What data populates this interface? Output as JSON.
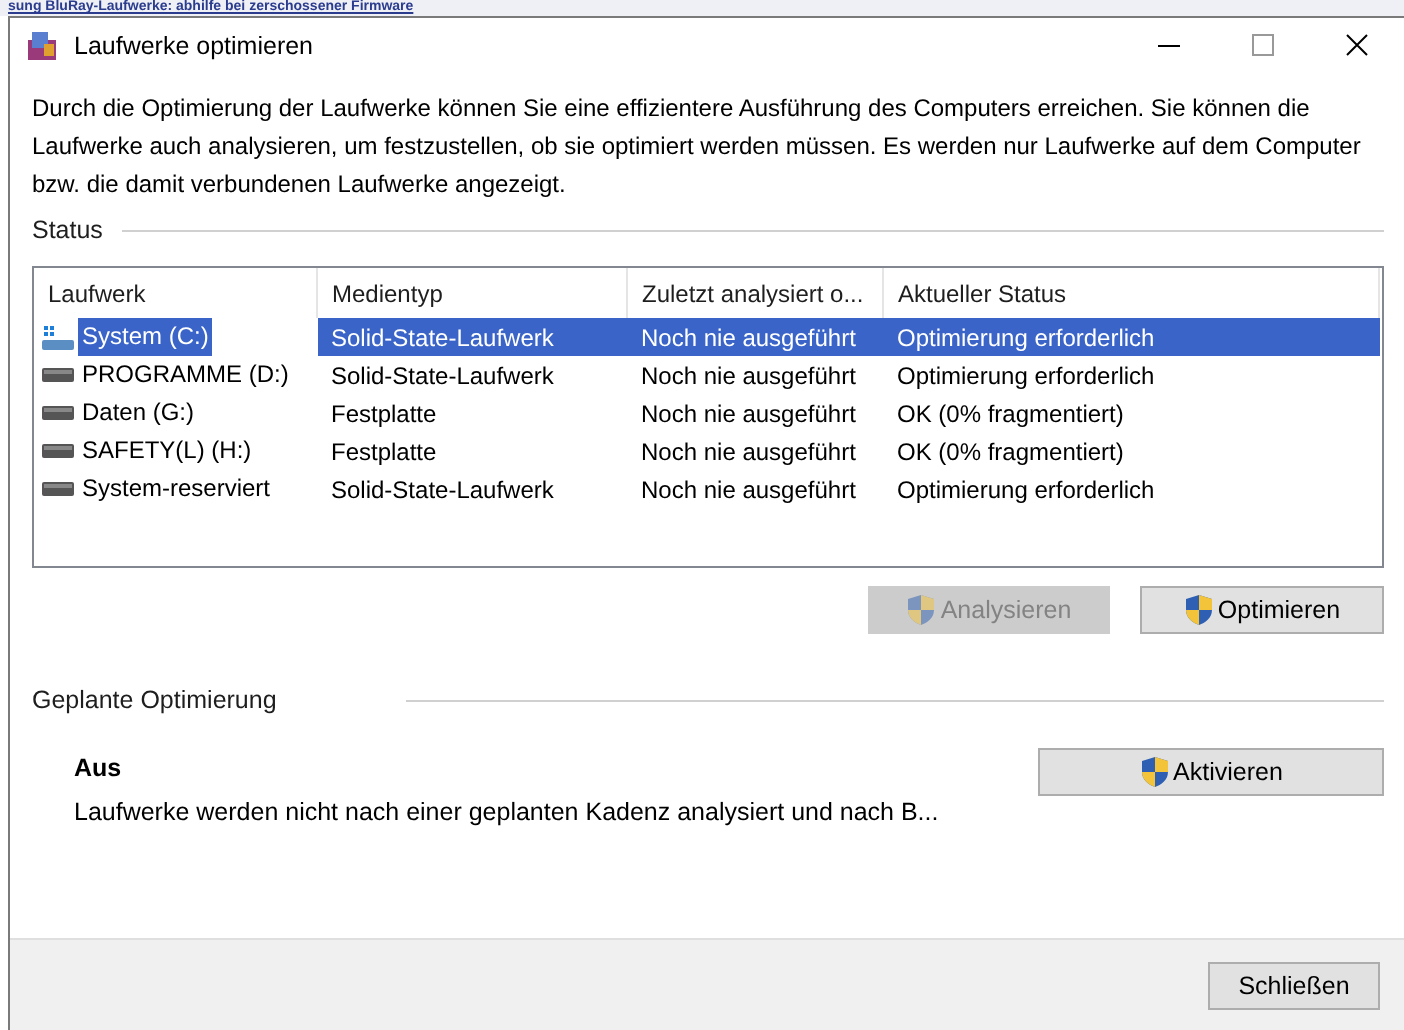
{
  "background_page": {
    "headline": "sung BluRay-Laufwerke: abhilfe bei zerschossener Firmware"
  },
  "window": {
    "title": "Laufwerke optimieren",
    "controls": [
      {
        "kind": "minimize"
      },
      {
        "kind": "maximize"
      },
      {
        "kind": "close"
      }
    ]
  },
  "intro": "Durch die Optimierung der Laufwerke können Sie eine effizientere Ausführung des Computers erreichen. Sie können die Laufwerke auch analysieren, um festzustellen, ob sie optimiert werden müssen. Es werden nur Laufwerke auf dem Computer bzw. die damit verbundenen Laufwerke angezeigt.",
  "status": {
    "heading": "Status",
    "table": {
      "columns": [
        "Laufwerk",
        "Medientyp",
        "Zuletzt analysiert o...",
        "Aktueller Status"
      ],
      "rows": [
        {
          "kind": "system",
          "selected": true,
          "cells": [
            "System (C:)",
            "Solid-State-Laufwerk",
            "Noch nie ausgeführt",
            "Optimierung erforderlich"
          ]
        },
        {
          "kind": "drive",
          "selected": false,
          "cells": [
            "PROGRAMME (D:)",
            "Solid-State-Laufwerk",
            "Noch nie ausgeführt",
            "Optimierung erforderlich"
          ]
        },
        {
          "kind": "drive",
          "selected": false,
          "cells": [
            "Daten (G:)",
            "Festplatte",
            "Noch nie ausgeführt",
            "OK (0% fragmentiert)"
          ]
        },
        {
          "kind": "drive",
          "selected": false,
          "cells": [
            "SAFETY(L) (H:)",
            "Festplatte",
            "Noch nie ausgeführt",
            "OK (0% fragmentiert)"
          ]
        },
        {
          "kind": "drive",
          "selected": false,
          "cells": [
            "System-reserviert",
            "Solid-State-Laufwerk",
            "Noch nie ausgeführt",
            "Optimierung erforderlich"
          ]
        }
      ]
    },
    "buttons": [
      {
        "label": "Analysieren",
        "disabled": true
      },
      {
        "label": "Optimieren",
        "disabled": false
      }
    ]
  },
  "scheduled": {
    "heading": "Geplante Optimierung",
    "state": "Aus",
    "description": "Laufwerke werden nicht nach einer geplanten Kadenz analysiert und nach B...",
    "button": {
      "label": "Aktivieren",
      "disabled": false
    }
  },
  "footer": {
    "close_button": "Schließen"
  }
}
